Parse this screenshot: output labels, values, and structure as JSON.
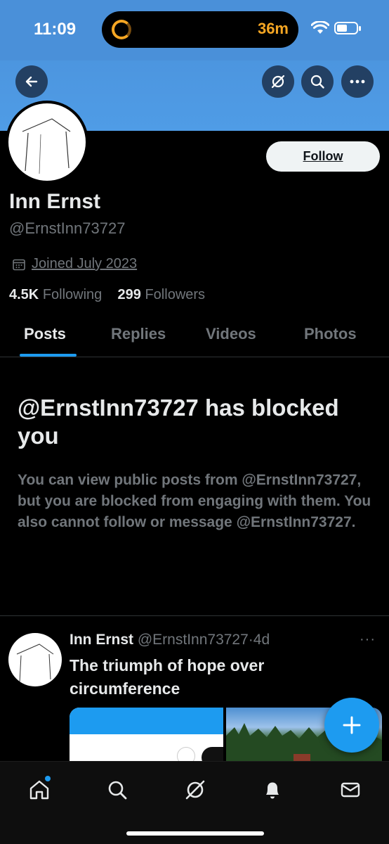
{
  "status_bar": {
    "time": "11:09",
    "activity_text": "36m",
    "activity_color": "#f5a623"
  },
  "header": {
    "back_icon": "arrow-left-icon",
    "grok_icon": "grok-icon",
    "search_icon": "search-icon",
    "more_icon": "more-horizontal-icon",
    "banner_color": "#4a90d9"
  },
  "profile": {
    "follow_label": "Follow",
    "display_name": "Inn Ernst",
    "handle": "@ErnstInn73727",
    "joined": "Joined July 2023",
    "following_count": "4.5K",
    "following_label": "Following",
    "followers_count": "299",
    "followers_label": "Followers"
  },
  "tabs": [
    {
      "label": "Posts",
      "active": true
    },
    {
      "label": "Replies",
      "active": false
    },
    {
      "label": "Videos",
      "active": false
    },
    {
      "label": "Photos",
      "active": false
    }
  ],
  "blocked": {
    "title": "@ErnstInn73727 has blocked you",
    "body": "You can view public posts from @ErnstInn73727, but you are blocked from engaging with them. You also cannot follow or message @ErnstInn73727."
  },
  "post": {
    "name": "Inn Ernst",
    "handle": "@ErnstInn73727",
    "separator": "·",
    "age": "4d",
    "text": "The triumph of hope over circumference",
    "more": "···"
  },
  "fab": {
    "icon": "compose-plus-icon"
  },
  "bottom_nav": [
    {
      "icon": "home-icon"
    },
    {
      "icon": "search-icon"
    },
    {
      "icon": "grok-icon"
    },
    {
      "icon": "notifications-bell-icon"
    },
    {
      "icon": "messages-envelope-icon"
    }
  ],
  "accent_color": "#1d9bf0"
}
